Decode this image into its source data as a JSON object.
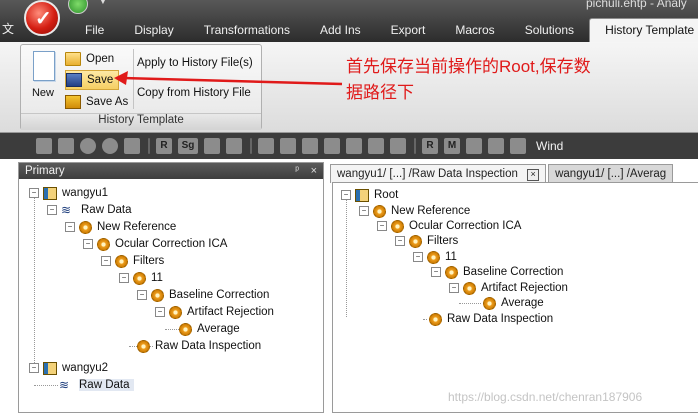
{
  "window": {
    "title": "pichuli.ehtp - Analy",
    "side_char": "文"
  },
  "menu": {
    "items": [
      "File",
      "Display",
      "Transformations",
      "Add Ins",
      "Export",
      "Macros",
      "Solutions",
      "History Template"
    ],
    "active": "History Template"
  },
  "ribbon": {
    "new_label": "New",
    "open_label": "Open",
    "save_label": "Save",
    "save_as_label": "Save As",
    "apply_label": "Apply to History File(s)",
    "copy_label": "Copy from History File",
    "group_label": "History Template"
  },
  "annotation": {
    "line1": "首先保存当前操作的Root,保存数",
    "line2": "据路径下",
    "color": "#e01a1a"
  },
  "toolbar": {
    "letters": [
      "R",
      "Sg",
      "R",
      "M"
    ],
    "label": "Wind"
  },
  "left_panel": {
    "title": "Primary",
    "pin": "ᵖ",
    "close": "×",
    "tree": [
      {
        "label": "wangyu1",
        "icon": "book-icon",
        "pm": "−"
      },
      {
        "label": "Raw Data",
        "icon": "wave-icon",
        "pm": "−"
      },
      {
        "label": "New Reference",
        "icon": "gear-icon",
        "pm": "−"
      },
      {
        "label": "Ocular Correction ICA",
        "icon": "gear-icon",
        "pm": "−"
      },
      {
        "label": "Filters",
        "icon": "gear-icon",
        "pm": "−"
      },
      {
        "label": "11",
        "icon": "gear-icon",
        "pm": "−"
      },
      {
        "label": "Baseline Correction",
        "icon": "gear-icon",
        "pm": "−"
      },
      {
        "label": "Artifact Rejection",
        "icon": "gear-icon",
        "pm": "−"
      },
      {
        "label": "Average",
        "icon": "gear-icon",
        "pm": ""
      },
      {
        "label": "Raw Data Inspection",
        "icon": "gear-icon",
        "pm": ""
      },
      {
        "label": "wangyu2",
        "icon": "book-icon",
        "pm": "−"
      },
      {
        "label": "Raw Data",
        "icon": "wave-icon",
        "pm": ""
      }
    ]
  },
  "tabs": [
    {
      "label": "wangyu1/ [...] /Raw Data Inspection",
      "close": "×"
    },
    {
      "label": "wangyu1/ [...] /Averag"
    }
  ],
  "right_tree": [
    {
      "label": "Root",
      "icon": "book-icon",
      "pm": "−"
    },
    {
      "label": "New Reference",
      "icon": "gear-icon",
      "pm": "−"
    },
    {
      "label": "Ocular Correction ICA",
      "icon": "gear-icon",
      "pm": "−"
    },
    {
      "label": "Filters",
      "icon": "gear-icon",
      "pm": "−"
    },
    {
      "label": "11",
      "icon": "gear-icon",
      "pm": "−"
    },
    {
      "label": "Baseline Correction",
      "icon": "gear-icon",
      "pm": "−"
    },
    {
      "label": "Artifact Rejection",
      "icon": "gear-icon",
      "pm": "−"
    },
    {
      "label": "Average",
      "icon": "gear-icon",
      "pm": ""
    },
    {
      "label": "Raw Data Inspection",
      "icon": "gear-icon",
      "pm": ""
    }
  ],
  "watermark": "https://blog.csdn.net/chenran187906"
}
